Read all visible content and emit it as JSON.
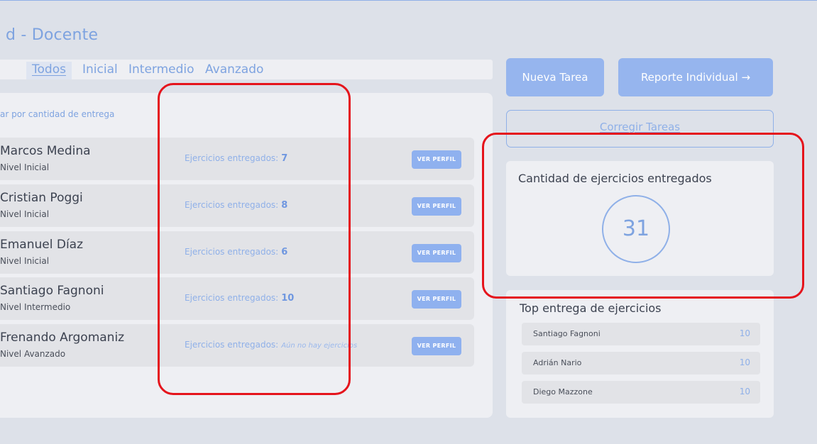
{
  "header": {
    "title": "d - Docente"
  },
  "tabs": [
    {
      "label": "Todos"
    },
    {
      "label": "Inicial"
    },
    {
      "label": "Intermedio"
    },
    {
      "label": "Avanzado"
    }
  ],
  "list": {
    "sort_label": "ar por cantidad de entrega",
    "delivered_label": "Ejercicios entregados:",
    "button_label": "VER PERFIL",
    "students": [
      {
        "name": "Marcos Medina",
        "level": "Nivel Inicial",
        "count": "7"
      },
      {
        "name": "Cristian Poggi",
        "level": "Nivel Inicial",
        "count": "8"
      },
      {
        "name": "Emanuel Díaz",
        "level": "Nivel Inicial",
        "count": "6"
      },
      {
        "name": "Santiago Fagnoni",
        "level": "Nivel Intermedio",
        "count": "10"
      },
      {
        "name": "Frenando Argomaniz",
        "level": "Nivel Avanzado",
        "count": "",
        "empty_note": "Aún no hay ejercicios"
      }
    ]
  },
  "actions": {
    "new_task": "Nueva Tarea",
    "report": "Reporte Individual →",
    "correct": "Corregir Tareas"
  },
  "stats": {
    "title": "Cantidad de ejercicios entregados",
    "total": "31"
  },
  "top": {
    "title": "Top entrega de ejercicios",
    "rows": [
      {
        "name": "Santiago Fagnoni",
        "value": "10"
      },
      {
        "name": "Adrián Nario",
        "value": "10"
      },
      {
        "name": "Diego Mazzone",
        "value": "10"
      }
    ]
  },
  "colors": {
    "accent": "#8fb0e8",
    "highlight": "#e5141c",
    "background": "#dde1e9"
  }
}
